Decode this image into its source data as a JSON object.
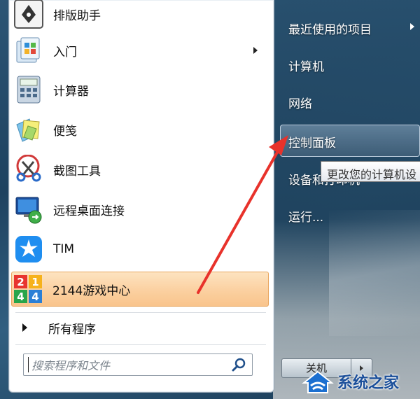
{
  "left_menu": {
    "items": [
      {
        "label": "排版助手",
        "icon": "pen-nib-icon"
      },
      {
        "label": "入门",
        "icon": "getting-started-icon",
        "has_submenu": true
      },
      {
        "label": "计算器",
        "icon": "calculator-icon"
      },
      {
        "label": "便笺",
        "icon": "sticky-notes-icon"
      },
      {
        "label": "截图工具",
        "icon": "scissors-icon"
      },
      {
        "label": "远程桌面连接",
        "icon": "remote-desktop-icon"
      },
      {
        "label": "TIM",
        "icon": "tim-star-icon"
      },
      {
        "label": "2144游戏中心",
        "icon": "game-center-2144-icon",
        "highlighted": true
      }
    ],
    "all_programs": "所有程序",
    "search_placeholder": "搜索程序和文件"
  },
  "right_menu": {
    "items": [
      {
        "label": "最近使用的项目",
        "has_submenu": true
      },
      {
        "label": "计算机"
      },
      {
        "label": "网络"
      },
      {
        "label": "控制面板",
        "highlighted": true
      },
      {
        "label": "设备和打印机"
      },
      {
        "label": "运行..."
      }
    ],
    "tooltip": "更改您的计算机设",
    "shutdown_label": "关机"
  },
  "watermark": {
    "text": "系统之家"
  },
  "colors": {
    "highlight_left": "#fbd0a0",
    "annotation_arrow": "#e8322b",
    "watermark_blue": "#1b4f9a"
  }
}
